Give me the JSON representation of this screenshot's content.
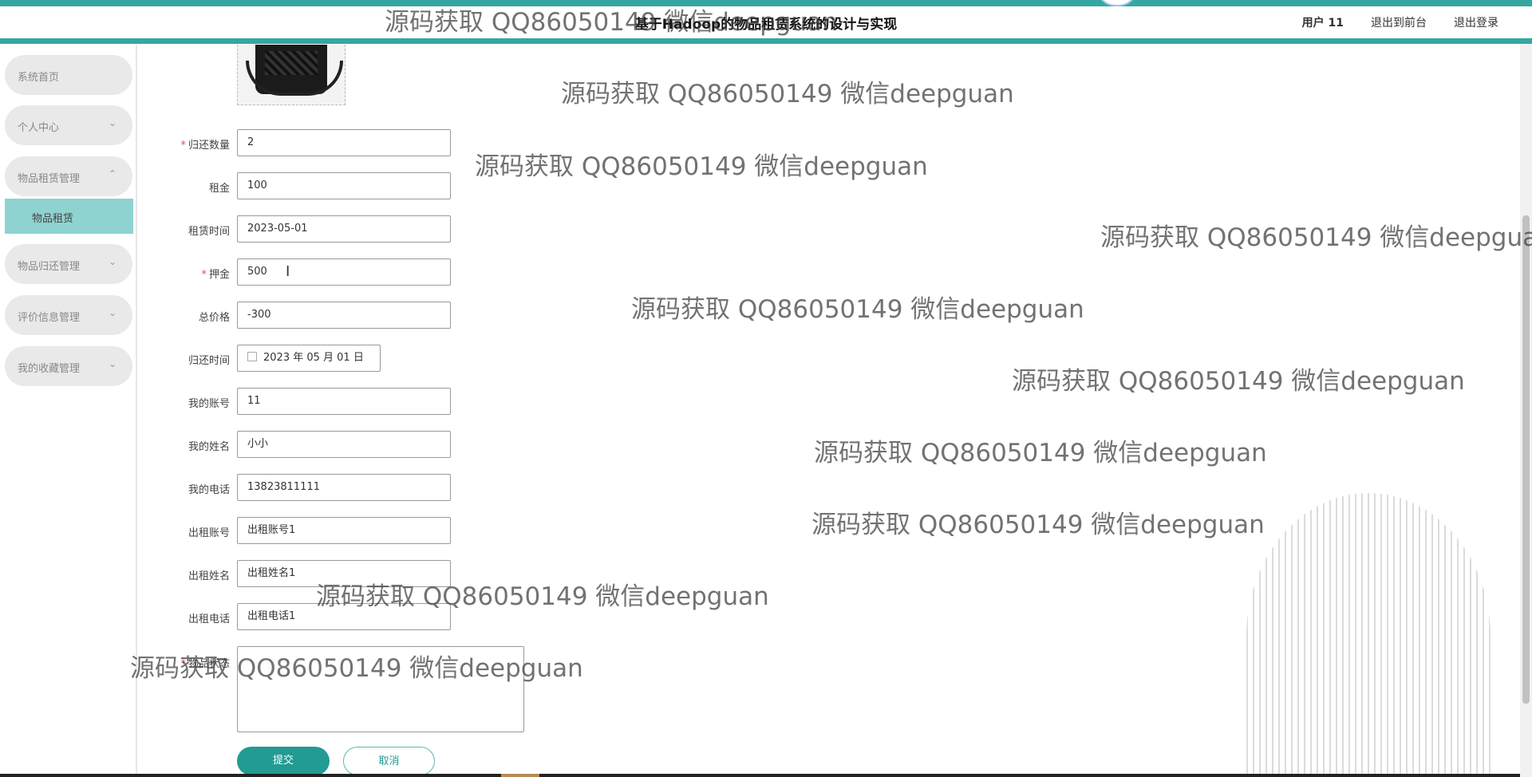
{
  "header": {
    "title": "基于Hadoop的物品租赁系统的设计与实现",
    "user": "用户 11",
    "back_front": "退出到前台",
    "logout": "退出登录"
  },
  "sidebar": {
    "items": [
      {
        "label": "系统首页"
      },
      {
        "label": "个人中心",
        "chevron": "⌄"
      },
      {
        "label": "物品租赁管理",
        "chevron": "⌃"
      },
      {
        "label": "物品归还管理",
        "chevron": "⌄"
      },
      {
        "label": "评价信息管理",
        "chevron": "⌄"
      },
      {
        "label": "我的收藏管理",
        "chevron": "⌄"
      }
    ],
    "subitem": "物品租赁"
  },
  "form": {
    "fields": [
      {
        "label": "归还数量",
        "required": true,
        "value": "2"
      },
      {
        "label": "租金",
        "required": false,
        "value": "100"
      },
      {
        "label": "租赁时间",
        "required": false,
        "value": "2023-05-01"
      },
      {
        "label": "押金",
        "required": true,
        "value": "500"
      },
      {
        "label": "总价格",
        "required": false,
        "value": "-300"
      },
      {
        "label": "归还时间",
        "required": false,
        "value": "2023 年 05 月 01 日"
      },
      {
        "label": "我的账号",
        "required": false,
        "value": "11"
      },
      {
        "label": "我的姓名",
        "required": false,
        "value": "小小"
      },
      {
        "label": "我的电话",
        "required": false,
        "value": "13823811111"
      },
      {
        "label": "出租账号",
        "required": false,
        "value": "出租账号1"
      },
      {
        "label": "出租姓名",
        "required": false,
        "value": "出租姓名1"
      },
      {
        "label": "出租电话",
        "required": false,
        "value": "出租电话1"
      },
      {
        "label": "物品状态",
        "required": true,
        "value": ""
      }
    ],
    "submit": "提交",
    "cancel": "取消"
  },
  "watermark": "源码获取 QQ86050149 微信deepguan",
  "icons": [
    "calendar-icon",
    "chevron-down-icon",
    "chevron-up-icon",
    "text-cursor-icon"
  ]
}
